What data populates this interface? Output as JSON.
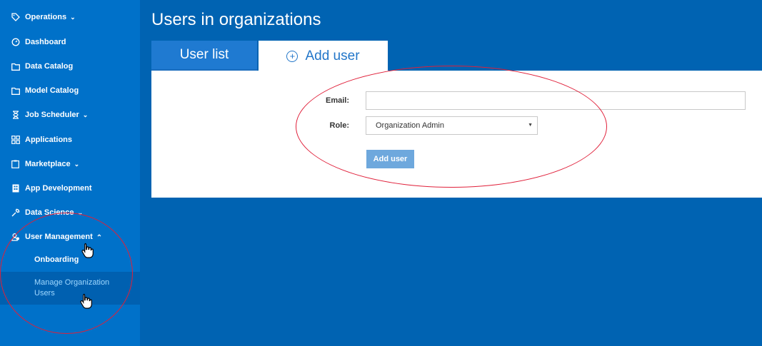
{
  "sidebar": {
    "items": [
      {
        "label": "Operations",
        "icon": "tag-icon",
        "has_chevron": true
      },
      {
        "label": "Dashboard",
        "icon": "gauge-icon",
        "has_chevron": false
      },
      {
        "label": "Data Catalog",
        "icon": "folder-icon",
        "has_chevron": false
      },
      {
        "label": "Model Catalog",
        "icon": "folder-icon",
        "has_chevron": false
      },
      {
        "label": "Job Scheduler",
        "icon": "hourglass-icon",
        "has_chevron": true
      },
      {
        "label": "Applications",
        "icon": "grid-icon",
        "has_chevron": false
      },
      {
        "label": "Marketplace",
        "icon": "clipboard-icon",
        "has_chevron": true
      },
      {
        "label": "App Development",
        "icon": "building-icon",
        "has_chevron": false
      },
      {
        "label": "Data Science",
        "icon": "wrench-icon",
        "has_chevron": true
      },
      {
        "label": "User Management",
        "icon": "users-icon",
        "has_chevron": true,
        "expanded": true
      }
    ],
    "subitems": [
      {
        "label": "Onboarding"
      },
      {
        "label": "Manage Organization Users",
        "active": true
      }
    ],
    "chevron_down": "⌄",
    "chevron_up": "⌃"
  },
  "main": {
    "title": "Users in organizations",
    "tabs": [
      {
        "label": "User list",
        "active": false
      },
      {
        "label": "Add user",
        "active": true,
        "icon": "plus-circle-icon"
      }
    ],
    "form": {
      "email_label": "Email:",
      "email_value": "",
      "role_label": "Role:",
      "role_value": "Organization Admin",
      "submit_label": "Add user"
    }
  },
  "colors": {
    "sidebar_bg": "#0071c9",
    "page_bg": "#0063b2",
    "accent": "#2276c9",
    "annotation": "#e0203a"
  }
}
